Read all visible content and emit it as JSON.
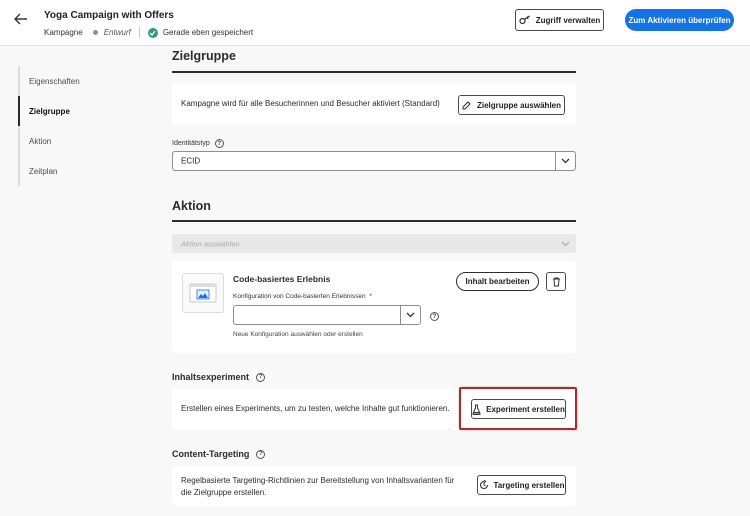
{
  "header": {
    "title": "Yoga Campaign with Offers",
    "type": "Kampagne",
    "status": "Entwurf",
    "saved": "Gerade eben gespeichert",
    "manage_access": "Zugriff verwalten",
    "review_activate": "Zum Aktivieren überprüfen"
  },
  "nav": {
    "items": [
      "Eigenschaften",
      "Zielgruppe",
      "Aktion",
      "Zeitplan"
    ],
    "active": "Zielgruppe"
  },
  "audience": {
    "title": "Zielgruppe",
    "description": "Kampagne wird für alle Besucherinnen und Besucher aktiviert (Standard)",
    "select_button": "Zielgruppe auswählen",
    "identity_label": "Identitätstyp",
    "identity_value": "ECID"
  },
  "action": {
    "title": "Aktion",
    "select_placeholder": "Aktion auswählen",
    "card_title": "Code-basiertes Erlebnis",
    "config_label": "Konfiguration von Code-basierten Erlebnissen",
    "required_mark": "*",
    "config_hint": "Neue Konfiguration auswählen oder erstellen",
    "edit_button": "Inhalt bearbeiten"
  },
  "experiment": {
    "title": "Inhaltsexperiment",
    "description": "Erstellen eines Experiments, um zu testen, welche Inhalte gut funktionieren.",
    "button": "Experiment erstellen",
    "highlight_color": "#b3262a"
  },
  "targeting": {
    "title": "Content-Targeting",
    "description_line1": "Regelbasierte Targeting-Richtlinien zur Bereitstellung von Inhaltsvarianten für",
    "description_line2": "die Zielgruppe erstellen.",
    "button": "Targeting erstellen"
  },
  "colors": {
    "accent": "#1473e6",
    "saved_check": "#2d9d78"
  }
}
